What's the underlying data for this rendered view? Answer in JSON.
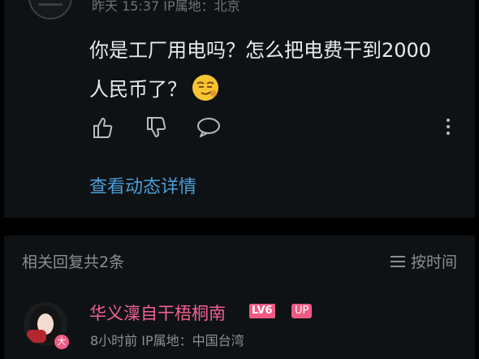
{
  "comment": {
    "meta": "昨天 15:37 IP属地：北京",
    "text": "你是工厂用电吗？怎么把电费干到2000人民币了？",
    "view_detail": "查看动态详情"
  },
  "replies": {
    "count_label": "相关回复共2条",
    "sort_label": "按时间",
    "first": {
      "username": "华义澟自干梧桐南",
      "level": "LV6",
      "up_badge": "UP",
      "vip_badge": "大",
      "meta": "8小时前 IP属地：中国台湾"
    }
  },
  "colors": {
    "accent_link": "#4a9fd6",
    "username_pink": "#f36191",
    "card_bg": "#0e1215"
  },
  "icons": [
    "thumbs-up-icon",
    "thumbs-down-icon",
    "comment-icon",
    "more-vertical-icon",
    "sort-lines-icon",
    "smirk-emoji"
  ]
}
